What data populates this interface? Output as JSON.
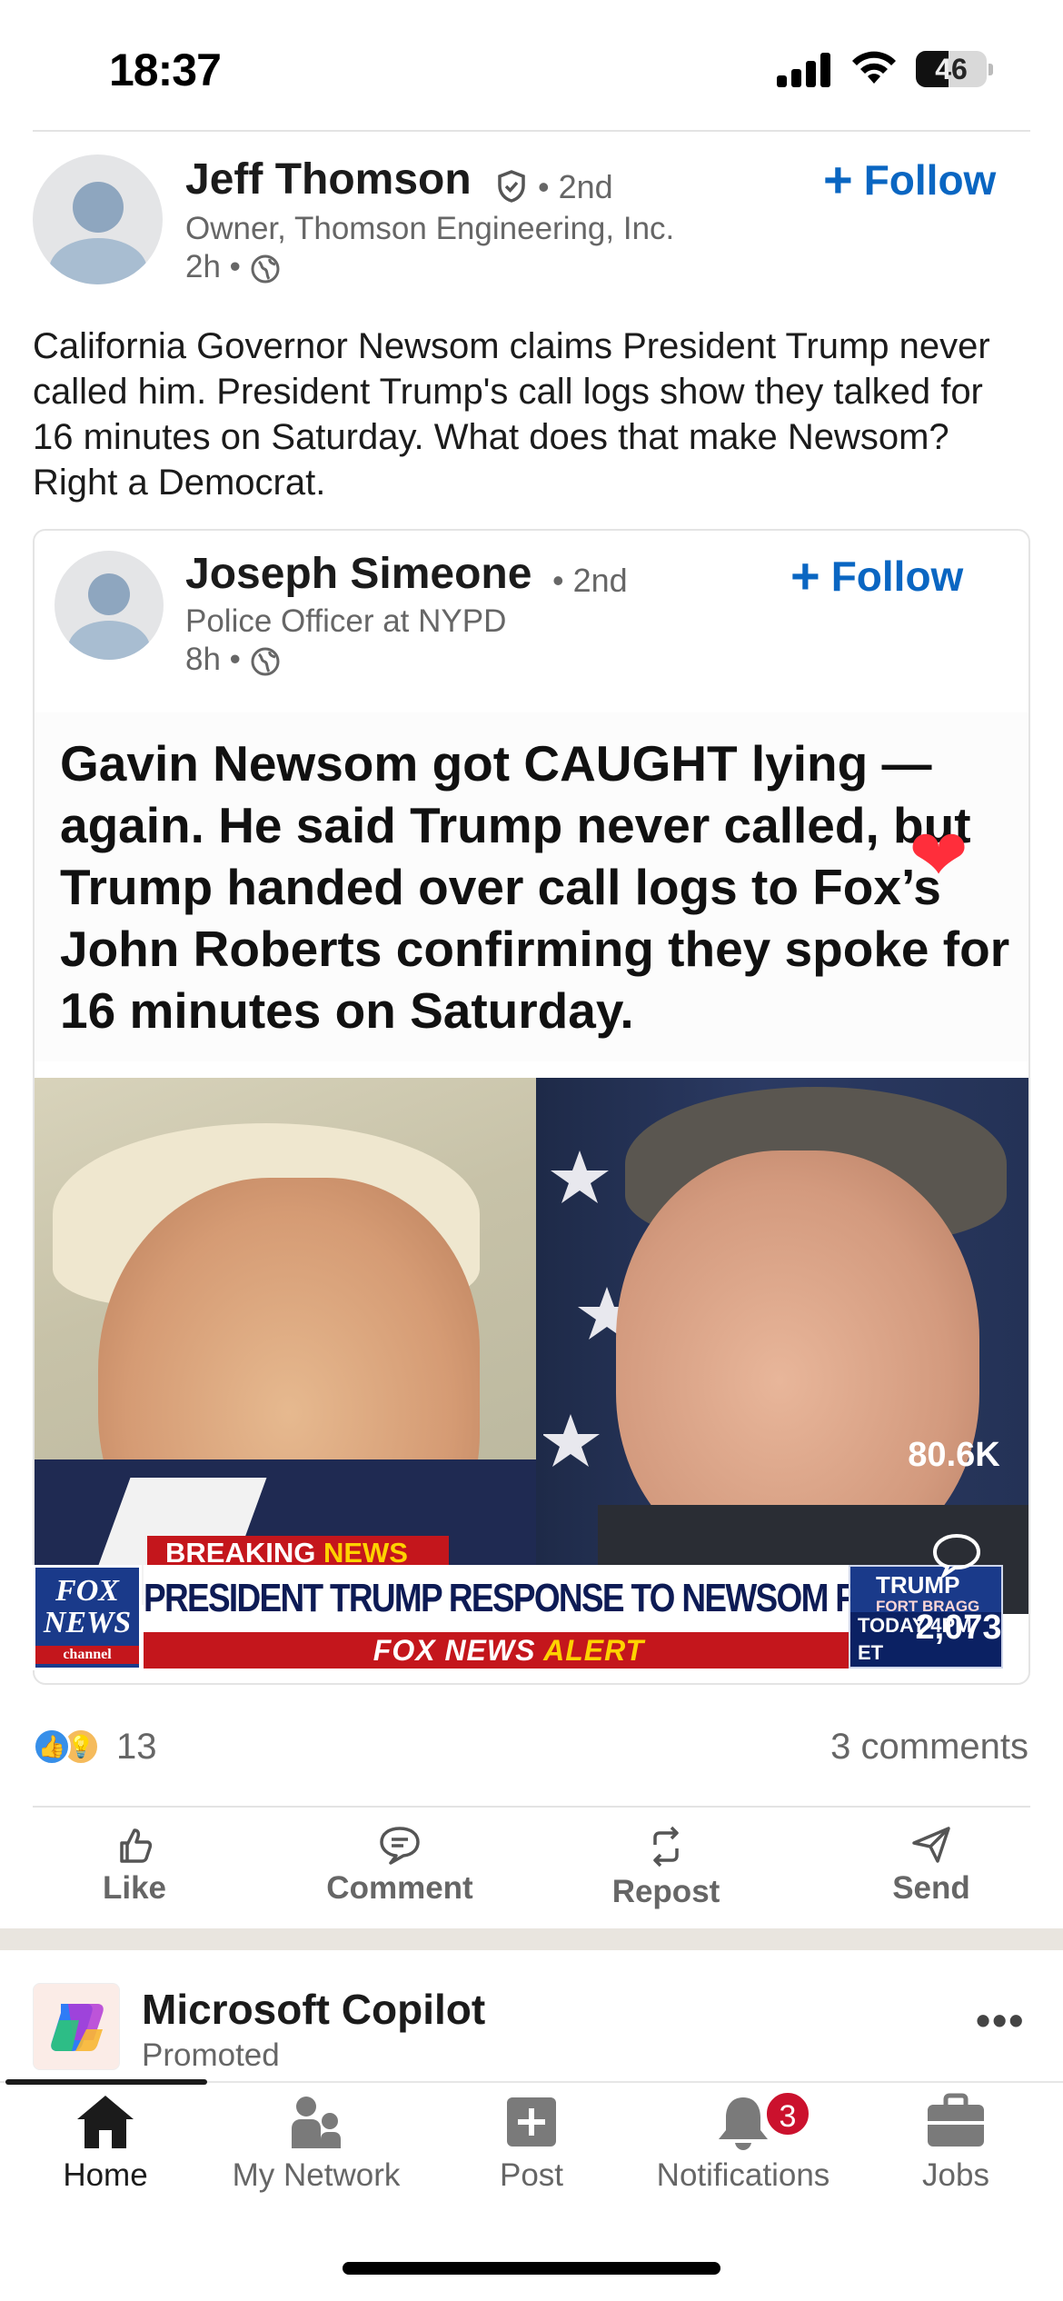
{
  "status_bar": {
    "time": "18:37",
    "battery": "46",
    "battery_level_percent": 46
  },
  "post": {
    "author_name": "Jeff Thomson",
    "degree": "• 2nd",
    "headline": "Owner, Thomson Engineering, Inc.",
    "time": "2h •",
    "follow_label": "Follow",
    "text": "California Governor Newsom claims President Trump never called him. President Trump's call logs show they talked for 16 minutes on Saturday. What does that make Newsom? Right a Democrat."
  },
  "reshare": {
    "author_name": "Joseph Simeone",
    "degree": "• 2nd",
    "headline": "Police Officer at NYPD",
    "time": "8h •",
    "follow_label": "Follow",
    "headline_text": "Gavin Newsom got CAUGHT lying — again. He said Trump never called, but Trump handed over call logs to Fox’s John Roberts confirming they spoke for 16 minutes on Saturday.",
    "video": {
      "breaking_prefix": "BREAKING ",
      "breaking_news": "NEWS",
      "fox_logo_line1": "FOX",
      "fox_logo_line2": "NEWS",
      "fox_logo_line3": "channel",
      "lower_third": "PRESIDENT TRUMP RESPONSE TO NEWSOM FEUD",
      "alert_prefix": "FOX NEWS ",
      "alert_word": "ALERT",
      "promo_line1": "TRUMP",
      "promo_line2": "FORT BRAGG REMARKS",
      "promo_line3": "TODAY 4PM ET",
      "likes": "80.6K",
      "comments": "2,073"
    }
  },
  "social": {
    "reaction_count": "13",
    "comments_label": "3 comments"
  },
  "actions": [
    {
      "label": "Like",
      "icon": "thumbs-up-icon"
    },
    {
      "label": "Comment",
      "icon": "comment-icon"
    },
    {
      "label": "Repost",
      "icon": "repost-icon"
    },
    {
      "label": "Send",
      "icon": "send-icon"
    }
  ],
  "promoted": {
    "name": "Microsoft Copilot",
    "sub": "Promoted",
    "more": "•••"
  },
  "tabs": [
    {
      "label": "Home",
      "icon": "home-icon",
      "active": true
    },
    {
      "label": "My Network",
      "icon": "network-icon"
    },
    {
      "label": "Post",
      "icon": "post-icon"
    },
    {
      "label": "Notifications",
      "icon": "bell-icon",
      "badge": "3"
    },
    {
      "label": "Jobs",
      "icon": "briefcase-icon"
    }
  ],
  "colors": {
    "accent": "#0a66c2",
    "badge": "#cb112d",
    "heart": "#ff2e3b"
  }
}
